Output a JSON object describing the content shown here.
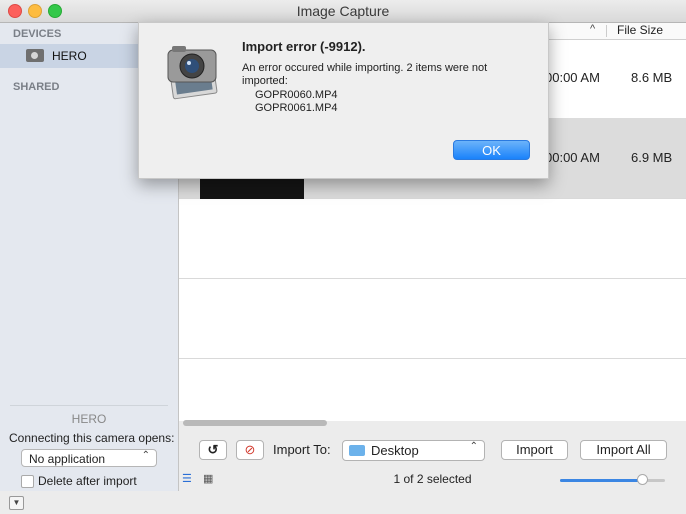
{
  "window": {
    "title": "Image Capture"
  },
  "sidebar": {
    "devices_header": "DEVICES",
    "device_name": "HERO",
    "shared_header": "SHARED"
  },
  "device_panel": {
    "name": "HERO",
    "opens_label": "Connecting this camera opens:",
    "app_value": "No application",
    "delete_label": "Delete after import"
  },
  "table": {
    "size_header": "File Size",
    "sort_indicator": "^",
    "rows": [
      {
        "time": "00:00 AM",
        "size": "8.6 MB"
      },
      {
        "time": "00:00 AM",
        "size": "6.9 MB"
      }
    ]
  },
  "toolbar": {
    "rotate_symbol": "↺",
    "delete_symbol": "⊘",
    "import_to_label": "Import To:",
    "destination": "Desktop",
    "import_label": "Import",
    "import_all_label": "Import All",
    "status": "1 of 2 selected",
    "thumbnail_size": 0.78
  },
  "alert": {
    "title": "Import error (-9912).",
    "message": "An error occured while importing. 2 items were not imported:",
    "items": [
      "GOPR0060.MP4",
      "GOPR0061.MP4"
    ],
    "ok_label": "OK"
  },
  "colors": {
    "accent": "#1a82fb",
    "sidebar_bg": "#e4e8ef"
  }
}
